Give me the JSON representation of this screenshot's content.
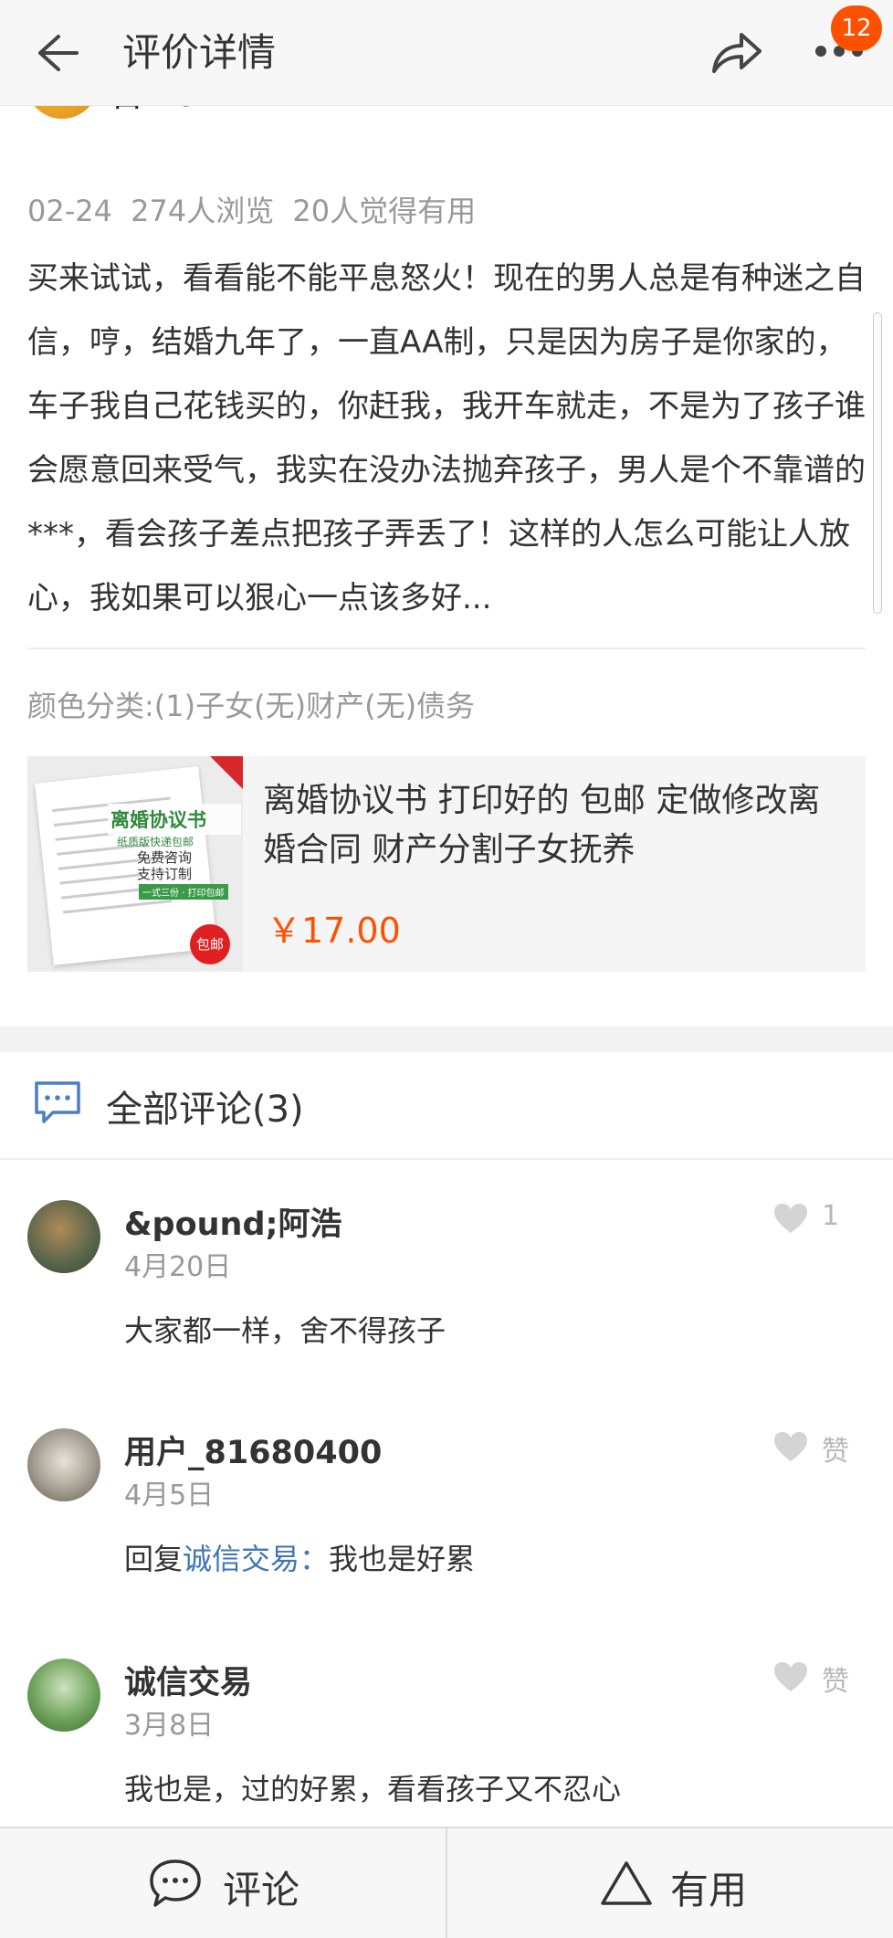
{
  "header": {
    "title": "评价详情",
    "badge_count": "12"
  },
  "reviewer": {
    "name": "石**9",
    "diamonds": "♦♦♦♦♦"
  },
  "review": {
    "date": "02-24",
    "views": "274人浏览",
    "useful": "20人觉得有用",
    "text": "买来试试，看看能不能平息怒火！现在的男人总是有种迷之自信，哼，结婚九年了，一直AA制，只是因为房子是你家的，车子我自己花钱买的，你赶我，我开车就走，不是为了孩子谁会愿意回来受气，我实在没办法抛弃孩子，男人是个不靠谱的***，看会孩子差点把孩子弄丢了！这样的人怎么可能让人放心，我如果可以狠心一点该多好...",
    "sku": "颜色分类:(1)子女(无)财产(无)债务"
  },
  "product": {
    "title": "离婚协议书 打印好的 包邮 定做修改离婚合同 财产分割子女抚养",
    "price": "￥17.00",
    "image_title": "离婚协议书",
    "image_small": "纸质版快递包邮",
    "image_sub1": "免费咨询",
    "image_sub2": "支持订制",
    "image_tag": "一式三份 · 打印包邮",
    "image_badge": "包邮"
  },
  "comments_header": {
    "title": "全部评论(3)"
  },
  "comments": [
    {
      "name": "&pound;阿浩",
      "date": "4月20日",
      "text": "大家都一样，舍不得孩子",
      "like_label": "1",
      "avatar_color": "#6b7a5a"
    },
    {
      "name": "用户_81680400",
      "date": "4月5日",
      "reply_prefix": "回复",
      "reply_target": "诚信交易：",
      "text": "我也是好累",
      "like_label": "赞",
      "avatar_color": "#a49e92"
    },
    {
      "name": "诚信交易",
      "date": "3月8日",
      "text": "我也是，过的好累，看看孩子又不忍心",
      "like_label": "赞",
      "avatar_color": "#6fa35c"
    }
  ],
  "bottom": {
    "comment_label": "评论",
    "useful_label": "有用"
  },
  "colors": {
    "accent": "#ff5000",
    "link": "#3e76b8",
    "muted": "#999999"
  }
}
